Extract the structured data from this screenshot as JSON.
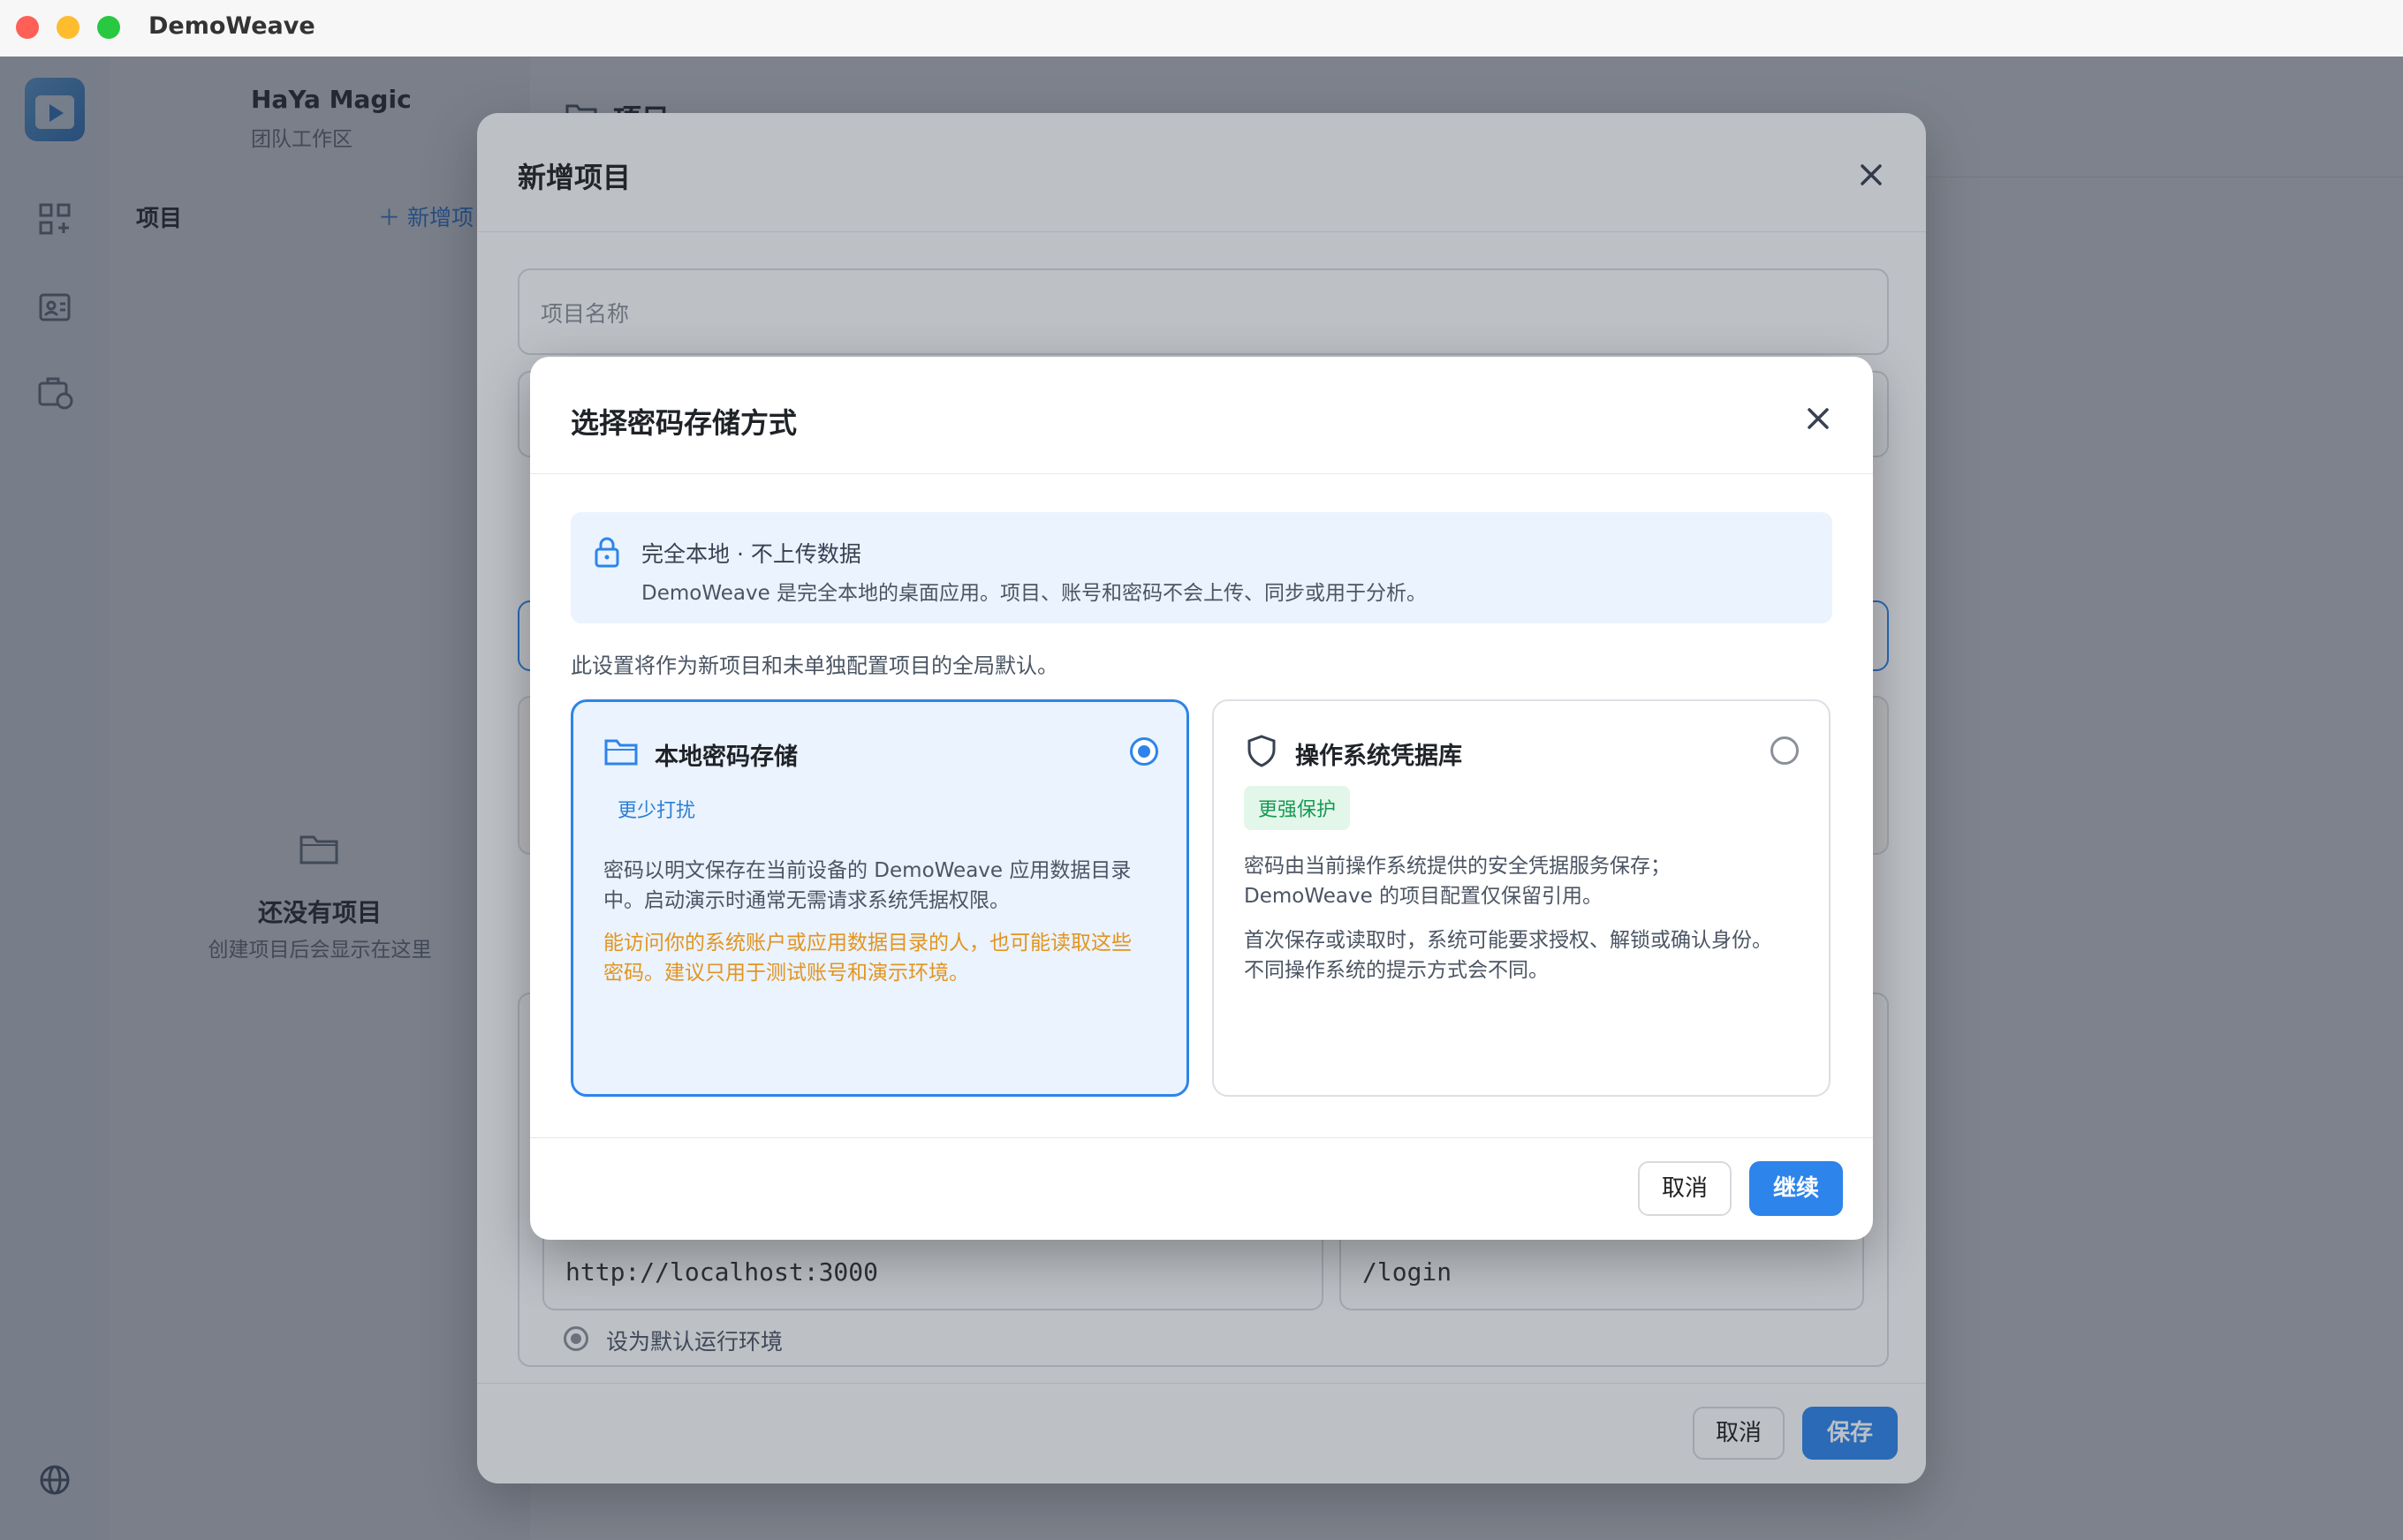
{
  "window": {
    "title": "DemoWeave"
  },
  "workspace": {
    "name": "HaYa Magic",
    "subtitle": "团队工作区"
  },
  "sidebar": {
    "projects_label": "项目",
    "new_project_label": "＋ 新增项目",
    "empty_title": "还没有项目",
    "empty_subtitle": "创建项目后会显示在这里"
  },
  "main": {
    "header_title": "项目"
  },
  "new_project_dialog": {
    "title": "新增项目",
    "name_placeholder": "项目名称",
    "base_url_value": "http://localhost:3000",
    "path_value": "/login",
    "default_env_label": "设为默认运行环境",
    "cancel_label": "取消",
    "save_label": "保存"
  },
  "storage_dialog": {
    "title": "选择密码存储方式",
    "banner_title": "完全本地 · 不上传数据",
    "banner_desc": "DemoWeave 是完全本地的桌面应用。项目、账号和密码不会上传、同步或用于分析。",
    "default_note": "此设置将作为新项目和未单独配置项目的全局默认。",
    "options": [
      {
        "title": "本地密码存储",
        "tag": "更少打扰",
        "desc_line1": "密码以明文保存在当前设备的 DemoWeave 应用数据目录",
        "desc_line2": "中。启动演示时通常无需请求系统凭据权限。",
        "warn_line1": "能访问你的系统账户或应用数据目录的人，也可能读取这些",
        "warn_line2": "密码。建议只用于测试账号和演示环境。",
        "selected": true
      },
      {
        "title": "操作系统凭据库",
        "tag": "更强保护",
        "desc_line1": "密码由当前操作系统提供的安全凭据服务保存；",
        "desc_line2": "DemoWeave 的项目配置仅保留引用。",
        "note_line1": "首次保存或读取时，系统可能要求授权、解锁或确认身份。",
        "note_line2": "不同操作系统的提示方式会不同。",
        "selected": false
      }
    ],
    "cancel_label": "取消",
    "continue_label": "继续"
  },
  "colors": {
    "accent": "#2d84ea",
    "warning": "#e39420",
    "success": "#169a52"
  }
}
